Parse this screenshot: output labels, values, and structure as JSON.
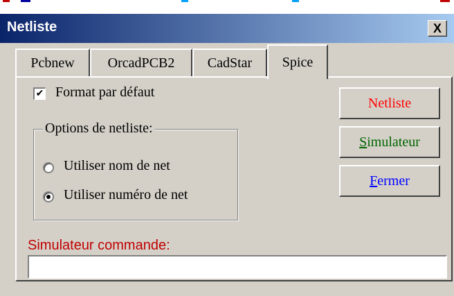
{
  "window": {
    "title": "Netliste",
    "close_label": "X"
  },
  "tabs": [
    {
      "label": "Pcbnew",
      "active": false
    },
    {
      "label": "OrcadPCB2",
      "active": false
    },
    {
      "label": "CadStar",
      "active": false
    },
    {
      "label": "Spice",
      "active": true
    }
  ],
  "options": {
    "default_format_label": "Format par défaut",
    "default_format_checked": true,
    "group_title": "Options de netliste:",
    "radio_net_name_label": "Utiliser nom de net",
    "radio_net_number_label": "Utiliser numéro de net",
    "selected": "net_number"
  },
  "buttons": {
    "netliste": {
      "label": "Netliste",
      "color": "#ff0000"
    },
    "simulateur": {
      "label": "Simulateur",
      "accel": "S",
      "rest": "imulateur",
      "color": "#006400"
    },
    "fermer": {
      "label": "Fermer",
      "accel": "F",
      "rest": "ermer",
      "color": "#0000ff"
    }
  },
  "command": {
    "label": "Simulateur commande:",
    "value": "",
    "label_color": "#c00000"
  },
  "colors": {
    "dialog_bg": "#d4d0c8",
    "titlebar_start": "#0a246a",
    "titlebar_end": "#a6caf0"
  },
  "icons": {
    "close": "close-icon",
    "checkbox": "checkmark-icon",
    "radio": "radio-dot-icon"
  }
}
